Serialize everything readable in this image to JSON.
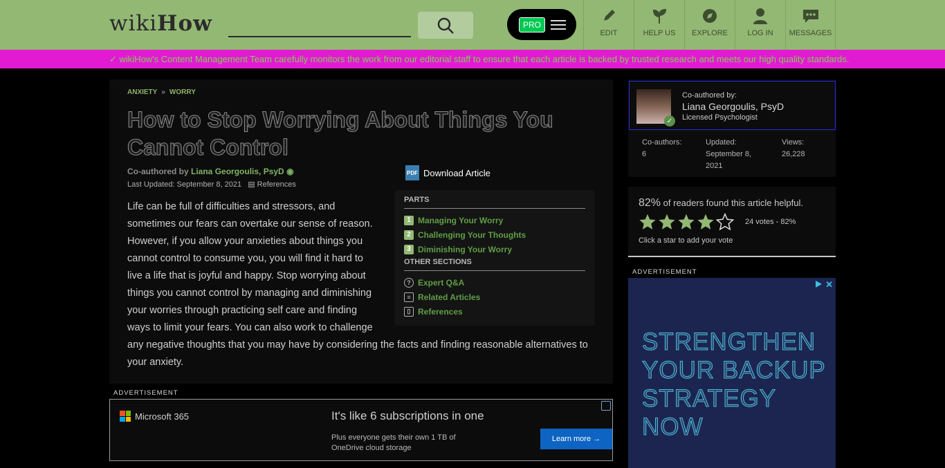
{
  "header": {
    "logo_wiki": "wiki",
    "logo_how": "How",
    "search_placeholder": "",
    "pro_label": "PRO",
    "nav": [
      {
        "label": "EDIT",
        "icon": "pencil-icon"
      },
      {
        "label": "HELP US",
        "icon": "sprout-icon"
      },
      {
        "label": "EXPLORE",
        "icon": "compass-icon"
      },
      {
        "label": "LOG IN",
        "icon": "user-icon"
      },
      {
        "label": "MESSAGES",
        "icon": "chat-icon"
      }
    ]
  },
  "banner": {
    "text": "wikiHow's Content Management Team carefully monitors the work from our editorial staff to ensure that each article is backed by trusted research and meets our high quality standards."
  },
  "article": {
    "breadcrumbs": [
      "ANXIETY",
      "WORRY"
    ],
    "breadcrumb_sep": "»",
    "title": "How to Stop Worrying About Things You Cannot Control",
    "coauthored_prefix": "Co-authored by",
    "author": "Liana Georgoulis, PsyD",
    "last_updated": "Last Updated: September 8, 2021",
    "references_label": "References",
    "download_label": "Download Article",
    "pdf_label": "PDF",
    "intro": "Life can be full of difficulties and stressors, and sometimes our fears can overtake our sense of reason. However, if you allow your anxieties about things you cannot control to consume you, you will find it hard to live a life that is joyful and happy. Stop worrying about things you cannot control by managing and diminishing your worries through practicing self care and finding ways to limit your fears. You can also work to challenge any negative thoughts that you may have by considering the facts and finding reasonable alternatives to your anxiety.",
    "toc": {
      "parts_heading": "PARTS",
      "parts": [
        {
          "num": "1",
          "label": "Managing Your Worry"
        },
        {
          "num": "2",
          "label": "Challenging Your Thoughts"
        },
        {
          "num": "3",
          "label": "Diminishing Your Worry"
        }
      ],
      "other_heading": "OTHER SECTIONS",
      "other": [
        {
          "icon": "question-icon",
          "label": "Expert Q&A"
        },
        {
          "icon": "document-icon",
          "label": "Related Articles"
        },
        {
          "icon": "bookmark-icon",
          "label": "References"
        }
      ]
    }
  },
  "ads": {
    "label": "ADVERTISEMENT",
    "ms_brand": "Microsoft 365",
    "ms_headline": "It's like 6 subscriptions in one",
    "ms_sub": "Plus everyone gets their own 1 TB of OneDrive cloud storage",
    "ms_button": "Learn more",
    "side_headline": "STRENGTHEN YOUR BACKUP STRATEGY NOW"
  },
  "sidebar": {
    "coauthored_label": "Co-authored by:",
    "author_name": "Liana Georgoulis, PsyD",
    "author_title": "Licensed Psychologist",
    "stats": [
      {
        "label": "Co-authors:",
        "value": "6"
      },
      {
        "label": "Updated:",
        "value": "September 8, 2021"
      },
      {
        "label": "Views:",
        "value": "26,228"
      }
    ],
    "helpful_pct": "82%",
    "helpful_text": "of readers found this article helpful.",
    "stars_filled": 4,
    "stars_total": 5,
    "votes_text": "24 votes - 82%",
    "click_vote": "Click a star to add your vote"
  },
  "colors": {
    "header_bg": "#93b874",
    "banner_bg": "#e21bd3",
    "link_green": "#80b465",
    "star_fill": "#93b874"
  }
}
